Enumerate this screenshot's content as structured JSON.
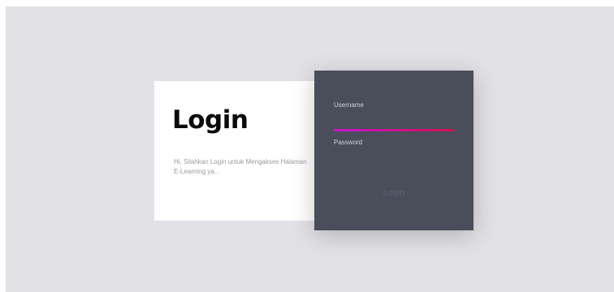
{
  "info_card": {
    "title": "Login",
    "description": "Hi, Silahkan Login untuk Mengakses Halaman E-Learning ya..."
  },
  "form": {
    "username_label": "Username",
    "username_value": "",
    "password_label": "Password",
    "password_value": "",
    "login_label": "Login"
  },
  "colors": {
    "background": "#e2e2e6",
    "info_card": "#ffffff",
    "form_card": "#4a4d5a",
    "underline_start": "#c813d6",
    "underline_end": "#d0134a"
  }
}
